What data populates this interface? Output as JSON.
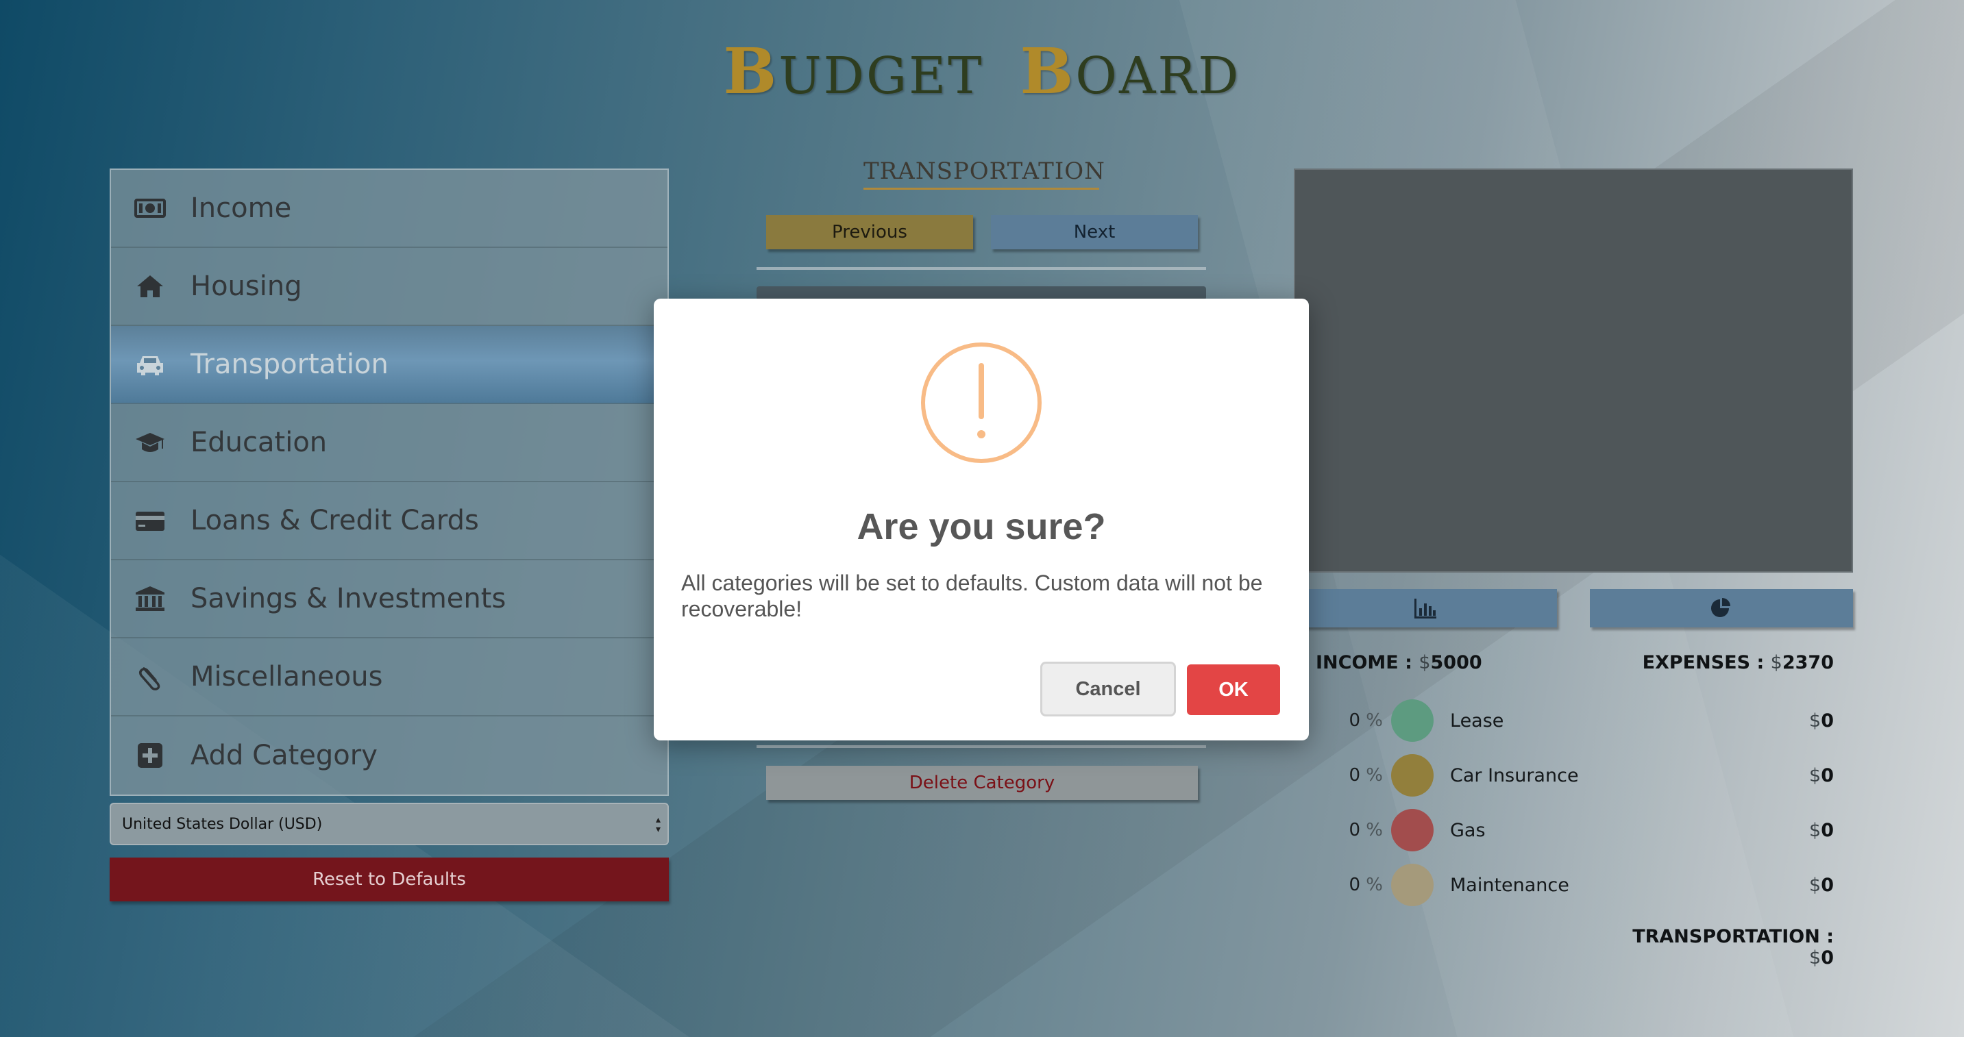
{
  "app": {
    "title_first_cap": "B",
    "title_first_rest": "UDGET",
    "title_second_cap": "B",
    "title_second_rest": "OARD"
  },
  "sidebar": {
    "items": [
      {
        "label": "Income",
        "icon": "money-bill-icon",
        "active": false
      },
      {
        "label": "Housing",
        "icon": "home-icon",
        "active": false
      },
      {
        "label": "Transportation",
        "icon": "car-icon",
        "active": true
      },
      {
        "label": "Education",
        "icon": "graduation-cap-icon",
        "active": false
      },
      {
        "label": "Loans & Credit Cards",
        "icon": "credit-card-icon",
        "active": false
      },
      {
        "label": "Savings & Investments",
        "icon": "bank-icon",
        "active": false
      },
      {
        "label": "Miscellaneous",
        "icon": "paperclip-icon",
        "active": false
      },
      {
        "label": "Add Category",
        "icon": "plus-square-icon",
        "active": false
      }
    ],
    "currency": {
      "selected": "United States Dollar (USD)"
    },
    "reset_label": "Reset to Defaults"
  },
  "middle": {
    "section_title": "TRANSPORTATION",
    "previous_label": "Previous",
    "next_label": "Next",
    "delete_label": "Delete Category"
  },
  "summary": {
    "income_label": "INCOME :",
    "income_value": "5000",
    "expenses_label": "EXPENSES :",
    "expenses_value": "2370",
    "currency_symbol": "$",
    "percent_symbol": "%",
    "items": [
      {
        "pct": "0",
        "name": "Lease",
        "amount": "0",
        "color": "#5d9b80"
      },
      {
        "pct": "0",
        "name": "Car Insurance",
        "amount": "0",
        "color": "#927f3c"
      },
      {
        "pct": "0",
        "name": "Gas",
        "amount": "0",
        "color": "#a24d4d"
      },
      {
        "pct": "0",
        "name": "Maintenance",
        "amount": "0",
        "color": "#a59a7b"
      }
    ],
    "category_total_label": "TRANSPORTATION :",
    "category_total_value": "0"
  },
  "modal": {
    "title": "Are you sure?",
    "text": "All categories will be set to defaults. Custom data will not be recoverable!",
    "cancel_label": "Cancel",
    "ok_label": "OK",
    "icon": "warning-exclamation-icon",
    "icon_color": "#f8bb86"
  }
}
